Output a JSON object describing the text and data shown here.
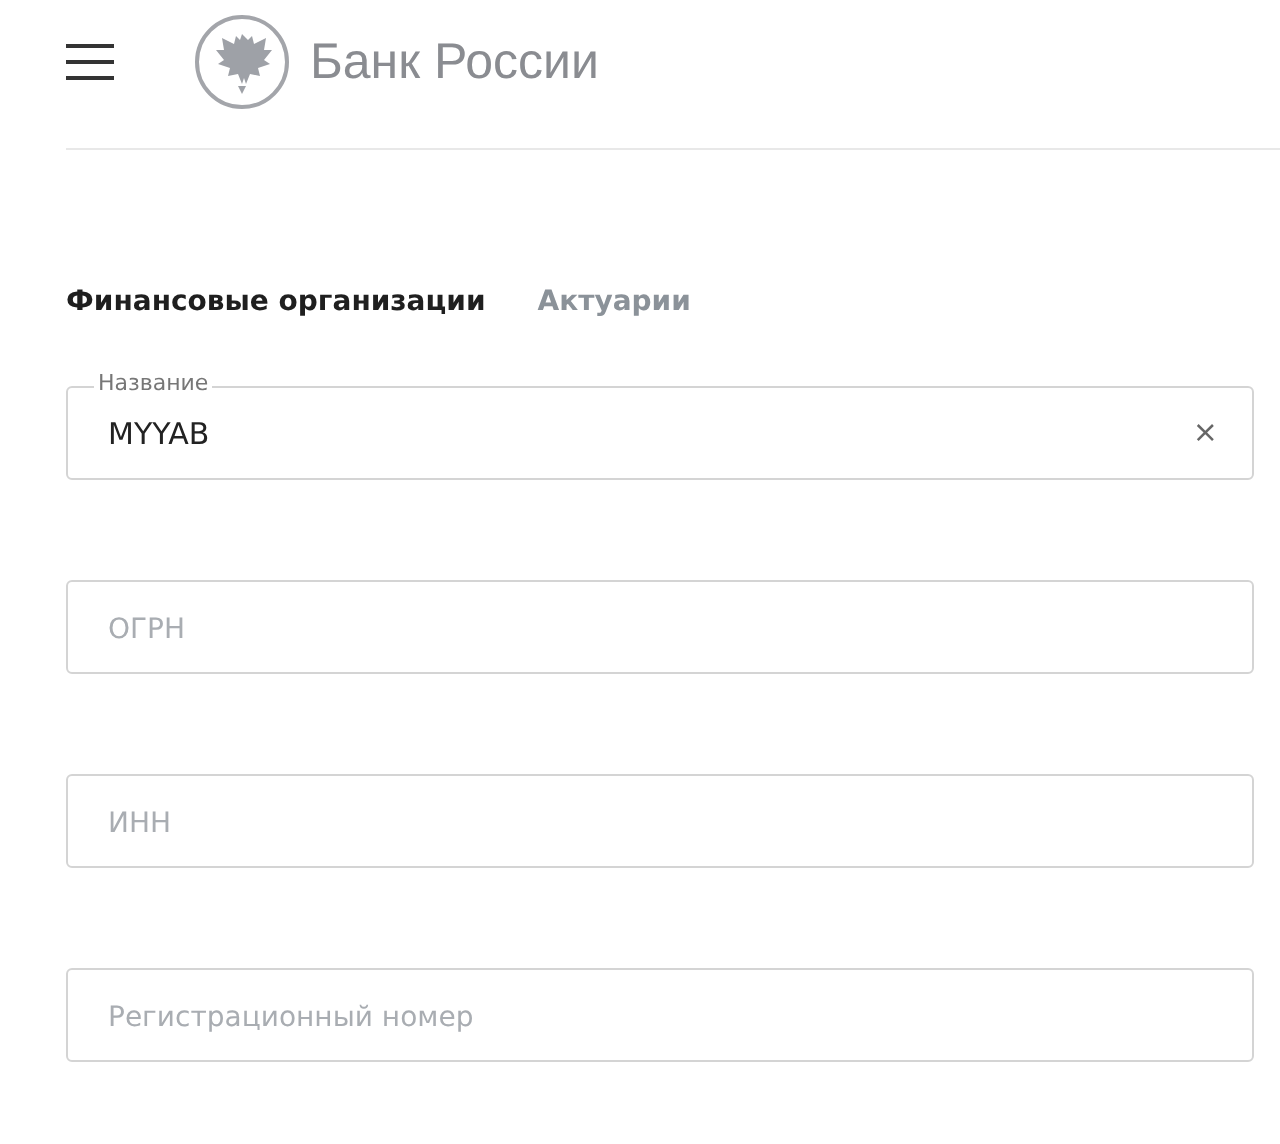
{
  "header": {
    "title": "Банк России"
  },
  "tabs": [
    {
      "label": "Финансовые организации",
      "selected": true
    },
    {
      "label": "Актуарии",
      "selected": false
    }
  ],
  "fields": [
    {
      "label": "Название",
      "value": "MYYAB",
      "clear": "×"
    },
    {
      "placeholder": "ОГРН"
    },
    {
      "placeholder": "ИНН"
    },
    {
      "placeholder": "Регистрационный номер"
    }
  ]
}
